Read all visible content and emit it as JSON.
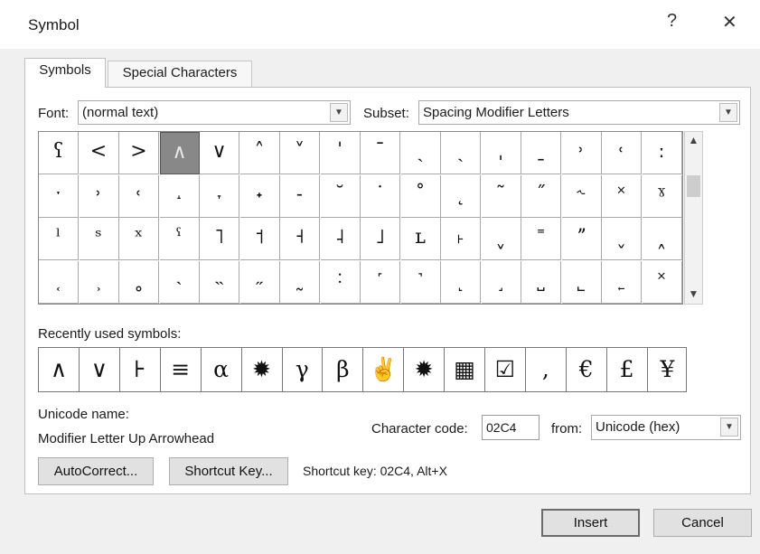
{
  "window": {
    "title": "Symbol",
    "help": "?",
    "close": "✕"
  },
  "tabs": {
    "symbols": "Symbols",
    "special": "Special Characters"
  },
  "font": {
    "label": "Font:",
    "value": "(normal text)"
  },
  "subset": {
    "label": "Subset:",
    "value": "Spacing Modifier Letters"
  },
  "grid": {
    "selected_row": 0,
    "selected_col": 3,
    "rows": [
      [
        "ʕ",
        "<",
        ">",
        "∧",
        "∨",
        "˄",
        "˅",
        "ˈ",
        "ˉ",
        "ˏ",
        "ˎ",
        "ˌ",
        "ˍ",
        "˒",
        "˓",
        "ː"
      ],
      [
        "ˑ",
        "˒",
        "˓",
        "˔",
        "˕",
        "˖",
        "˗",
        "˘",
        "˙",
        "˚",
        "˛",
        "˜",
        "˝",
        "˞",
        "˟",
        "ˠ"
      ],
      [
        "ˡ",
        "ˢ",
        "ˣ",
        "ˤ",
        "˥",
        "˦",
        "˧",
        "˨",
        "˩",
        "ʟ",
        "˫",
        "ˬ",
        "˭",
        "ˮ",
        "˯",
        "˰"
      ],
      [
        "˱",
        "˲",
        "˳",
        "˴",
        "˵",
        "˶",
        "˷",
        "˸",
        "˹",
        "˺",
        "˻",
        "˼",
        "˽",
        "˾",
        "˿",
        "˟"
      ]
    ],
    "scroll_up": "▲",
    "scroll_down": "▼"
  },
  "recent": {
    "label": "Recently used symbols:",
    "symbols": [
      "∧",
      "∨",
      "⊦",
      "≡",
      "α",
      "✹",
      "γ",
      "β",
      "✌",
      "✹",
      "▦",
      "☑",
      ",",
      "€",
      "£",
      "¥"
    ]
  },
  "unicode": {
    "label": "Unicode name:",
    "value": "Modifier Letter Up Arrowhead"
  },
  "charcode": {
    "label": "Character code:",
    "value": "02C4"
  },
  "from": {
    "label": "from:",
    "value": "Unicode (hex)"
  },
  "buttons": {
    "autocorrect": "AutoCorrect...",
    "shortcut_key": "Shortcut Key...",
    "insert": "Insert",
    "cancel": "Cancel"
  },
  "shortcut": {
    "text": "Shortcut key: 02C4, Alt+X"
  }
}
